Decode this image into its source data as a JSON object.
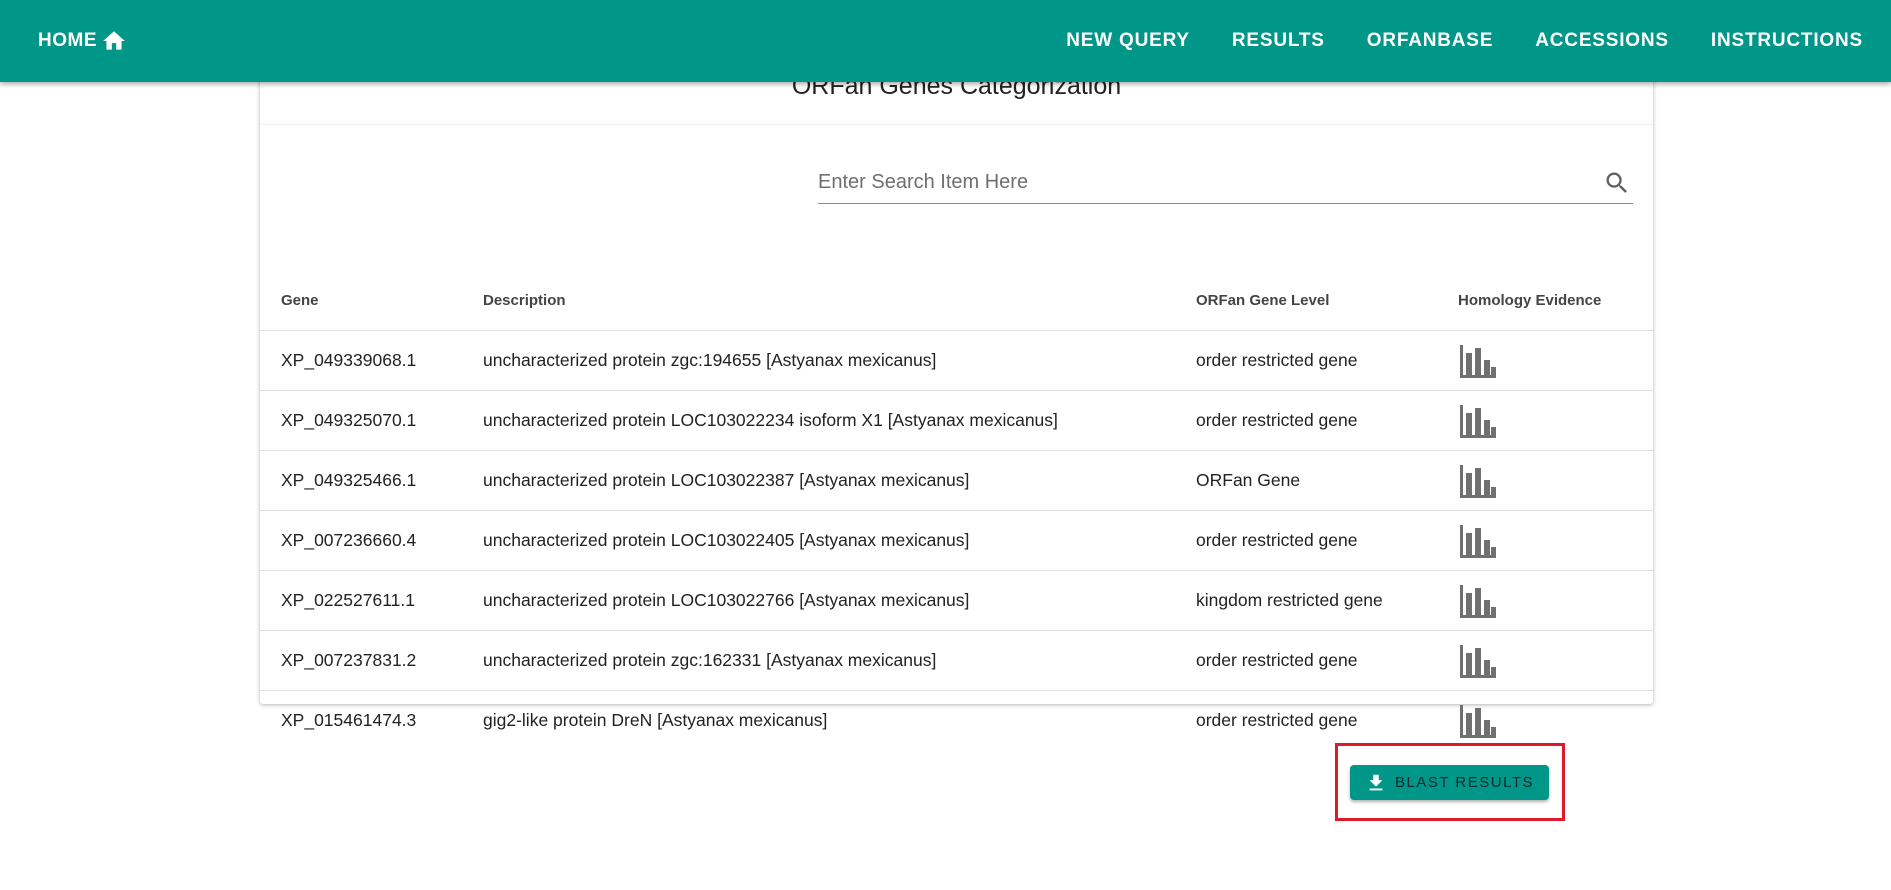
{
  "header": {
    "home_label": "HOME",
    "home_icon": "home-icon",
    "nav": [
      "NEW QUERY",
      "RESULTS",
      "ORFANBASE",
      "ACCESSIONS",
      "INSTRUCTIONS"
    ],
    "bg_color": "#009688"
  },
  "card": {
    "title": "ORFan Genes Categorization"
  },
  "search": {
    "placeholder": "Enter Search Item Here",
    "value": "",
    "icon": "search-icon"
  },
  "table": {
    "columns": [
      "Gene",
      "Description",
      "ORFan Gene Level",
      "Homology Evidence"
    ],
    "rows": [
      {
        "gene": "XP_049339068.1",
        "description": "uncharacterized protein zgc:194655 [Astyanax mexicanus]",
        "level": "order restricted gene",
        "evidence_icon": "bar-chart-icon"
      },
      {
        "gene": "XP_049325070.1",
        "description": "uncharacterized protein LOC103022234 isoform X1 [Astyanax mexicanus]",
        "level": "order restricted gene",
        "evidence_icon": "bar-chart-icon"
      },
      {
        "gene": "XP_049325466.1",
        "description": "uncharacterized protein LOC103022387 [Astyanax mexicanus]",
        "level": "ORFan Gene",
        "evidence_icon": "bar-chart-icon"
      },
      {
        "gene": "XP_007236660.4",
        "description": "uncharacterized protein LOC103022405 [Astyanax mexicanus]",
        "level": "order restricted gene",
        "evidence_icon": "bar-chart-icon"
      },
      {
        "gene": "XP_022527611.1",
        "description": "uncharacterized protein LOC103022766 [Astyanax mexicanus]",
        "level": "kingdom restricted gene",
        "evidence_icon": "bar-chart-icon"
      },
      {
        "gene": "XP_007237831.2",
        "description": "uncharacterized protein zgc:162331 [Astyanax mexicanus]",
        "level": "order restricted gene",
        "evidence_icon": "bar-chart-icon"
      },
      {
        "gene": "XP_015461474.3",
        "description": "gig2-like protein DreN [Astyanax mexicanus]",
        "level": "order restricted gene",
        "evidence_icon": "bar-chart-icon"
      }
    ]
  },
  "download_button": {
    "label": "BLAST RESULTS",
    "icon": "download-icon",
    "highlight_color": "#e0192a"
  }
}
